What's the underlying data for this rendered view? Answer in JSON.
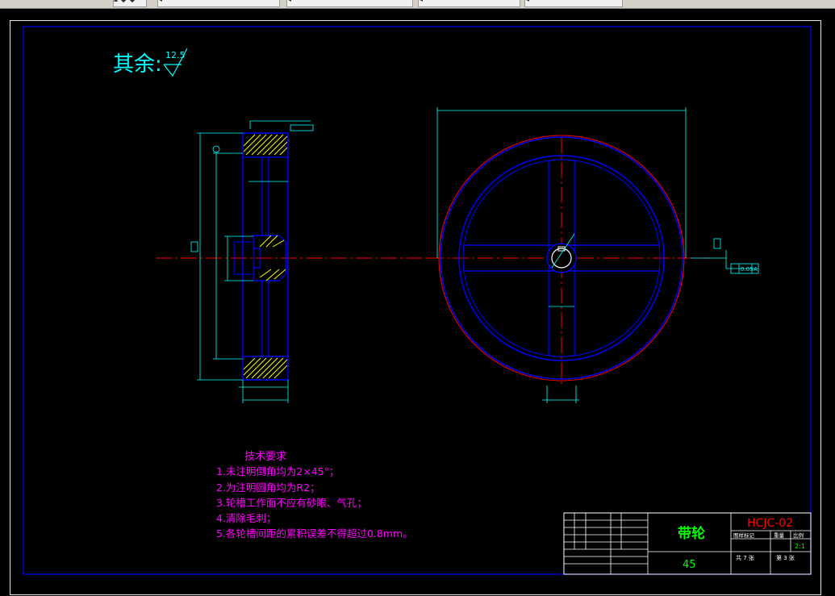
{
  "tabs": [
    {
      "label": "▴ ◆ ◆"
    },
    {
      "label": "◂ ⋯ ⋯ ⋯"
    },
    {
      "label": "◂ ⋯ ⋯ ⋯"
    },
    {
      "label": "◂ ⋯ ⋯ ⋯"
    },
    {
      "label": "◂ ⋯ ⋯ ⋯"
    }
  ],
  "roughness": {
    "label": "其余:",
    "value": "12.5"
  },
  "tech": {
    "title": "技术要求",
    "lines": [
      "1.未注明倒角均为2×45°；",
      "2.为注明圆角均为R2；",
      "3.轮槽工作面不应有砂眼、气孔；",
      "4.清除毛刺；",
      "5.各轮槽间距的累积误差不得超过0.8mm。"
    ]
  },
  "titleblock": {
    "part_name": "带轮",
    "material": "45",
    "drawing_no": "HCJC-02",
    "scale": "2:1",
    "col_labels": [
      "图样标记",
      "重量",
      "比例"
    ],
    "sheet_total": "共 7 张",
    "sheet_no": "第 3 张",
    "tolerance": "0.05",
    "datum": "A"
  },
  "colors": {
    "cad_bg": "#000000",
    "frame": "#0000ff",
    "outline": "#ffffff",
    "dimension": "#00ffff",
    "centerline": "#ff0000",
    "hatch": "#ffff00",
    "annotation_text": "#ff00ff",
    "title_green": "#00ff00"
  }
}
